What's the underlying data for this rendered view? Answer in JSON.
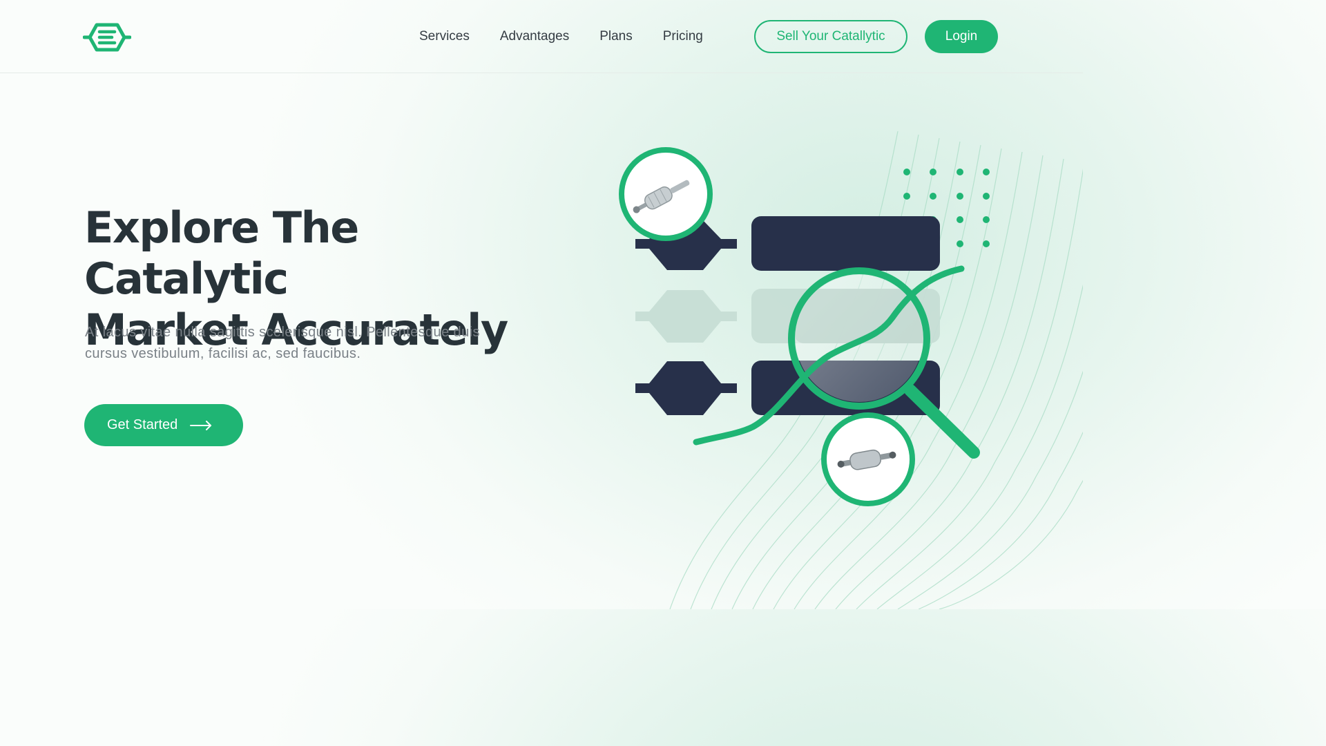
{
  "brand": {
    "accent": "#1fb574",
    "navy": "#27304a",
    "heading_color": "#283339"
  },
  "header": {
    "logo_icon": "catalytic-converter-logo",
    "nav": [
      {
        "label": "Services"
      },
      {
        "label": "Advantages"
      },
      {
        "label": "Plans"
      },
      {
        "label": "Pricing"
      }
    ],
    "sell_label": "Sell Your Catallytic",
    "login_label": "Login"
  },
  "hero": {
    "title_line1": "Explore The Catalytic",
    "title_line2": "Market Accurately",
    "subtitle_line1": "At lacus vitae nulla sagittis scelerisque nisl. Pellentesque duis",
    "subtitle_line2": "cursus vestibulum, facilisi ac, sed faucibus.",
    "cta_label": "Get Started",
    "cta_icon": "arrow-right-icon"
  },
  "illustration": {
    "icons": [
      "catalytic-converter-photo",
      "magnifier-icon",
      "trend-line",
      "dot-grid"
    ]
  }
}
